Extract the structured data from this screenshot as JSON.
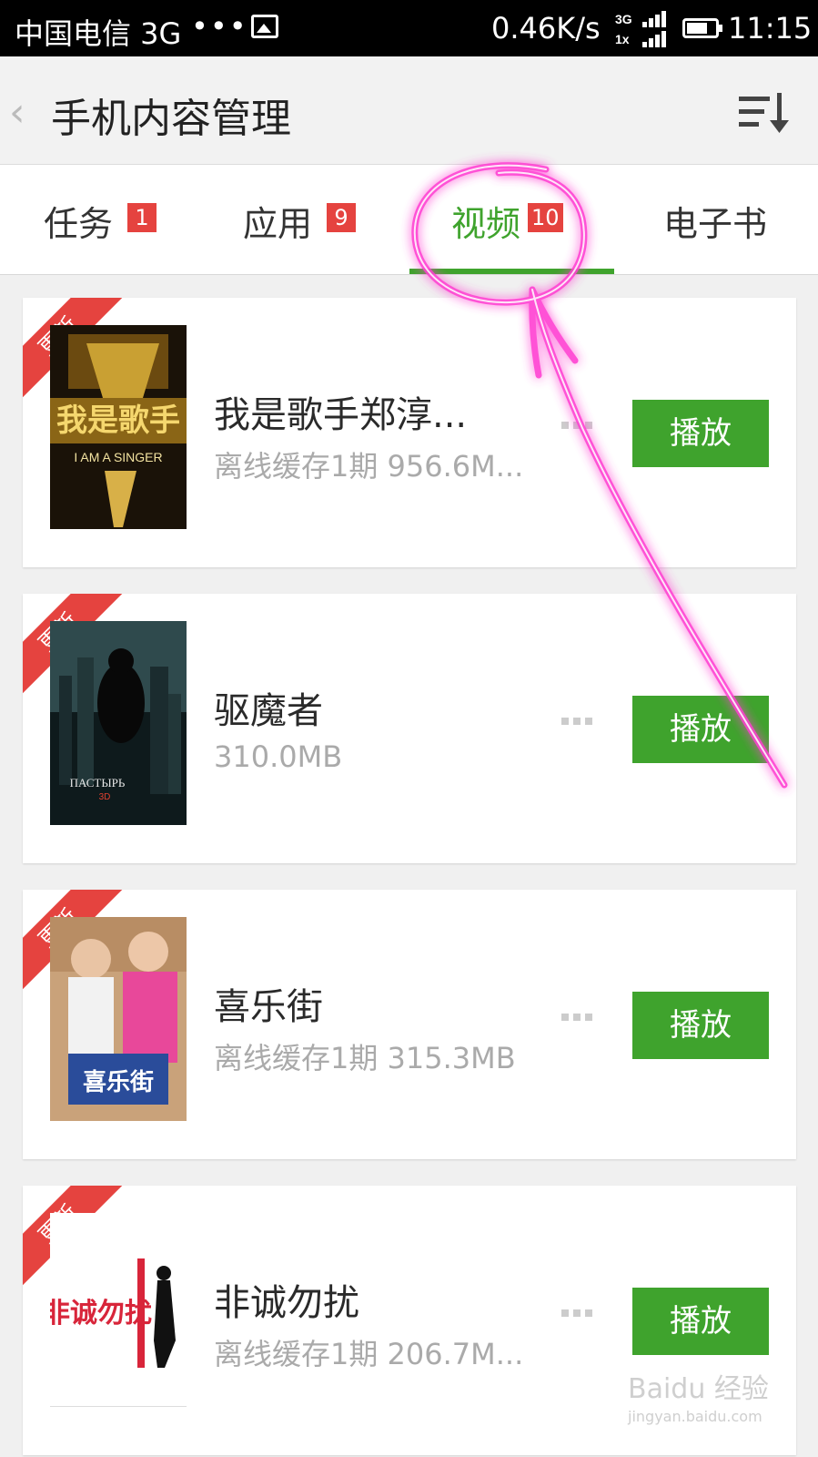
{
  "status_bar": {
    "carrier": "中国电信 3G",
    "dots": "•••",
    "speed": "0.46K/s",
    "network": "3G",
    "network2": "1x",
    "time": "11:15"
  },
  "header": {
    "back_glyph": "‹",
    "title": "手机内容管理"
  },
  "tabs": [
    {
      "label": "任务",
      "badge": "1",
      "active": false
    },
    {
      "label": "应用",
      "badge": "9",
      "active": false
    },
    {
      "label": "视频",
      "badge": "10",
      "active": true
    },
    {
      "label": "电子书",
      "badge": "",
      "active": false
    }
  ],
  "videos": [
    {
      "ribbon": "更新",
      "title": "我是歌手郑淳...",
      "subtitle": "离线缓存1期 956.6M...",
      "play_label": "播放",
      "poster_text": "我是歌手",
      "poster_sub": "I AM A SINGER"
    },
    {
      "ribbon": "更新",
      "title": "驱魔者",
      "subtitle": "310.0MB",
      "play_label": "播放",
      "poster_text": "ПАСТЫРЬ",
      "poster_sub": "3D"
    },
    {
      "ribbon": "更新",
      "title": "喜乐街",
      "subtitle": "离线缓存1期 315.3MB",
      "play_label": "播放",
      "poster_text": "喜乐街",
      "poster_sub": ""
    },
    {
      "ribbon": "更新",
      "title": "非诚勿扰",
      "subtitle": "离线缓存1期 206.7M...",
      "play_label": "播放",
      "poster_text": "非诚勿扰",
      "poster_sub": ""
    }
  ],
  "watermark": {
    "text": "Baidu 经验",
    "url": "jingyan.baidu.com"
  },
  "colors": {
    "accent_green": "#3fa32d",
    "badge_red": "#e5433f",
    "annotation_magenta": "#ff3fd2"
  }
}
